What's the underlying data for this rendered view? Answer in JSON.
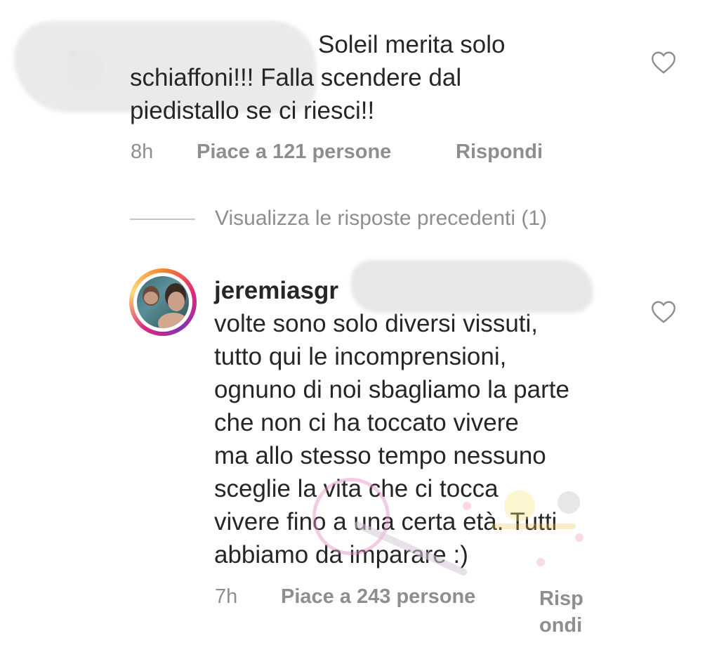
{
  "comment1": {
    "line1": "Soleil merita solo",
    "line2": "schiaffoni!!! Falla scendere dal",
    "line3": "piedistallo se ci riesci!!",
    "time": "8h",
    "likes": "Piace a 121 persone",
    "reply": "Rispondi",
    "like_icon": "heart-outline-icon"
  },
  "view_replies": "Visualizza le risposte precedenti (1)",
  "comment2": {
    "username": "jeremiasgr",
    "lines": [
      "volte sono solo diversi vissuti,",
      "tutto qui le incomprensioni,",
      "ognuno di noi sbagliamo la parte",
      "che non ci ha toccato vivere",
      "ma allo stesso tempo nessuno",
      "sceglie la vita che ci tocca",
      "vivere fino a una certa età. Tutti",
      "abbiamo da imparare :)"
    ],
    "time": "7h",
    "likes": "Piace a 243 persone",
    "reply_line1": "Risp",
    "reply_line2": "ondi",
    "like_icon": "heart-outline-icon"
  },
  "colors": {
    "text": "#262626",
    "secondary": "#8e8e8e",
    "story_ring": [
      "#f58529",
      "#dd2a7b",
      "#8134af",
      "#feda77"
    ]
  }
}
